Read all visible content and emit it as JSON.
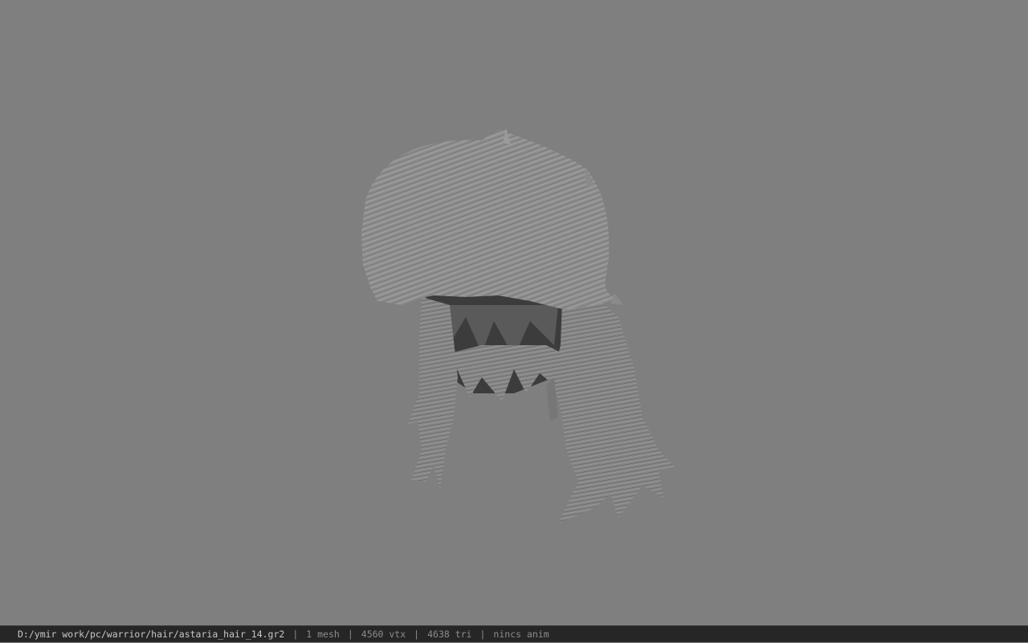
{
  "viewer": {
    "background_color": "#7f7f7f",
    "model_icon": "hair-model-icon"
  },
  "statusbar": {
    "file_path": "D:/ymir work/pc/warrior/hair/astaria_hair_14.gr2",
    "separator": "|",
    "mesh_count": "1 mesh",
    "vertex_count": "4560 vtx",
    "triangle_count": "4638 tri",
    "anim_status": "nincs anim"
  }
}
